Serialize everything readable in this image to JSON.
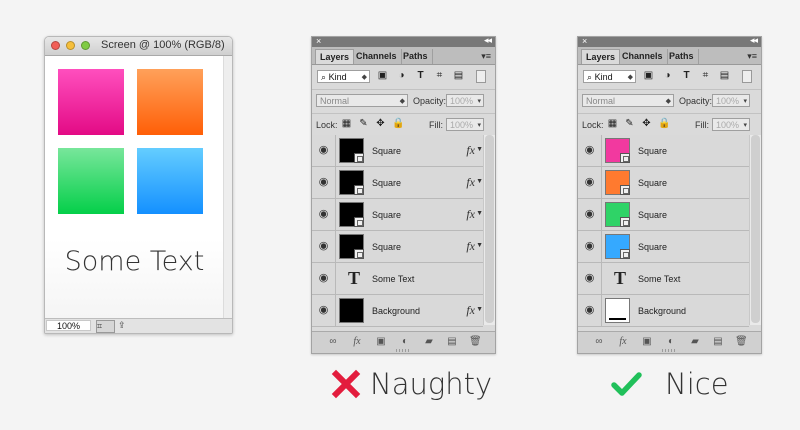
{
  "document_window": {
    "title": "Screen @ 100% (RGB/8)",
    "canvas_text": "Some Text",
    "zoom_level": "100%",
    "swatches": [
      {
        "name": "pink",
        "top_color": "#ff4fbe",
        "bottom_color": "#e30a85"
      },
      {
        "name": "orange",
        "top_color": "#ffa15a",
        "bottom_color": "#ff5f07"
      },
      {
        "name": "green",
        "top_color": "#78e69b",
        "bottom_color": "#04cf49"
      },
      {
        "name": "blue",
        "top_color": "#64cdff",
        "bottom_color": "#1490ff"
      }
    ]
  },
  "layers_panel": {
    "tabs": [
      "Layers",
      "Channels",
      "Paths"
    ],
    "kind_label": "Kind",
    "blend_mode": "Normal",
    "opacity_label": "Opacity:",
    "opacity_value": "100%",
    "lock_label": "Lock:",
    "fill_label": "Fill:",
    "fill_value": "100%"
  },
  "panels": [
    {
      "id": "naughty",
      "verdict_label": "Naughty",
      "verdict_color": "#e31c3d",
      "layers": [
        {
          "name": "Square",
          "type": "shape",
          "thumbnail": "black",
          "has_fx": true
        },
        {
          "name": "Square",
          "type": "shape",
          "thumbnail": "black",
          "has_fx": true
        },
        {
          "name": "Square",
          "type": "shape",
          "thumbnail": "black",
          "has_fx": true
        },
        {
          "name": "Square",
          "type": "shape",
          "thumbnail": "black",
          "has_fx": true
        },
        {
          "name": "Some Text",
          "type": "text",
          "thumbnail": "T",
          "has_fx": false
        },
        {
          "name": "Background",
          "type": "background",
          "thumbnail": "black",
          "has_fx": true
        }
      ]
    },
    {
      "id": "nice",
      "verdict_label": "Nice",
      "verdict_color": "#20c05a",
      "layers": [
        {
          "name": "Square",
          "type": "shape",
          "thumbnail": "pink",
          "has_fx": false
        },
        {
          "name": "Square",
          "type": "shape",
          "thumbnail": "orange",
          "has_fx": false
        },
        {
          "name": "Square",
          "type": "shape",
          "thumbnail": "green",
          "has_fx": false
        },
        {
          "name": "Square",
          "type": "shape",
          "thumbnail": "blue",
          "has_fx": false
        },
        {
          "name": "Some Text",
          "type": "text",
          "thumbnail": "T",
          "has_fx": false
        },
        {
          "name": "Background",
          "type": "background",
          "thumbnail": "white",
          "has_fx": false
        }
      ]
    }
  ],
  "icons": {
    "visibility": "eye-icon",
    "text_layer": "text-layer-icon",
    "mask": "vector-mask-icon",
    "link": "link-icon",
    "effects": "fx-icon",
    "adjustment": "adjustment-icon",
    "group": "folder-icon",
    "new_layer": "new-layer-icon",
    "delete": "trash-icon",
    "bad": "cross-icon",
    "good": "check-icon"
  },
  "thumbnail_colors": {
    "black": "#000000",
    "white": "#ffffff",
    "pink": "#f2399f",
    "orange": "#ff7a2f",
    "green": "#2fd367",
    "blue": "#35a9ff"
  }
}
